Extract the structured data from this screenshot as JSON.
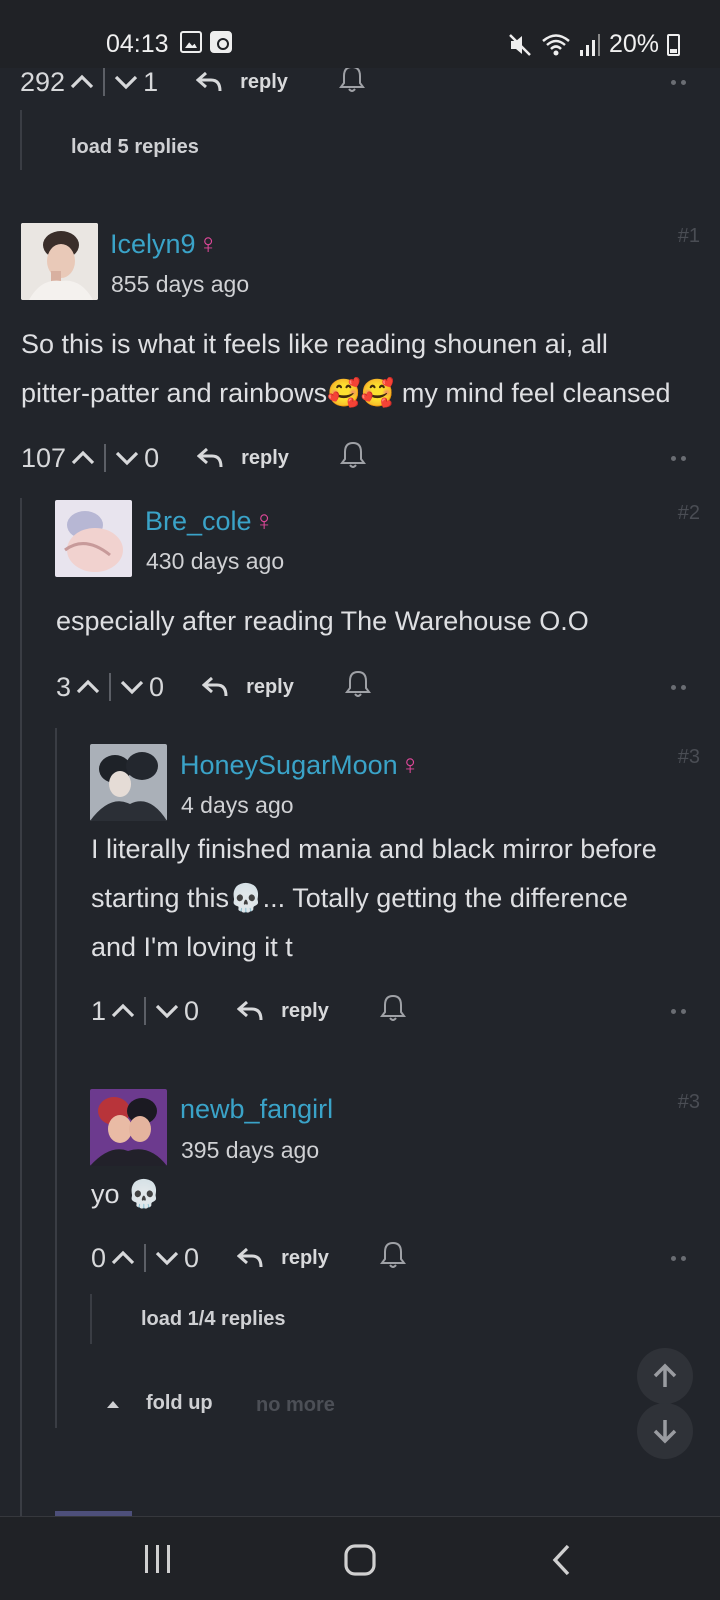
{
  "status_bar": {
    "time": "04:13",
    "battery": "20%",
    "icons": [
      "gallery-icon",
      "screen-record-icon",
      "mute-icon",
      "wifi-icon",
      "signal-icon",
      "battery-icon"
    ]
  },
  "top_comment_tail": {
    "upvotes": "292",
    "downvotes": "1",
    "reply_label": "reply",
    "load_replies": "load 5 replies"
  },
  "comments": [
    {
      "username": "Icelyn9",
      "gender": "♀",
      "age": "855 days ago",
      "tag": "#1",
      "text_line1": "So this is what it feels like reading shounen ai, all",
      "text_line2": "pitter-patter and rainbows🥰🥰 my mind feel cleansed",
      "upvotes": "107",
      "downvotes": "0",
      "reply_label": "reply"
    },
    {
      "username": "Bre_cole",
      "gender": "♀",
      "age": "430 days ago",
      "tag": "#2",
      "text_line1": "especially after reading The Warehouse O.O",
      "upvotes": "3",
      "downvotes": "0",
      "reply_label": "reply"
    },
    {
      "username": "HoneySugarMoon",
      "gender": "♀",
      "age": "4 days ago",
      "tag": "#3",
      "text_line1": "I literally finished mania and black mirror before",
      "text_line2": "starting this💀... Totally getting the difference",
      "text_line3": "and I'm loving it t",
      "upvotes": "1",
      "downvotes": "0",
      "reply_label": "reply"
    },
    {
      "username": "newb_fangirl",
      "age": "395 days ago",
      "tag": "#3",
      "text_line1": "yo 💀",
      "upvotes": "0",
      "downvotes": "0",
      "reply_label": "reply",
      "load_replies": "load 1/4 replies"
    }
  ],
  "fold_up_label": "fold up",
  "no_more_label": "no more",
  "colors": {
    "background": "#22252b",
    "username": "#3aa3c8",
    "venus": "#e0489a"
  }
}
